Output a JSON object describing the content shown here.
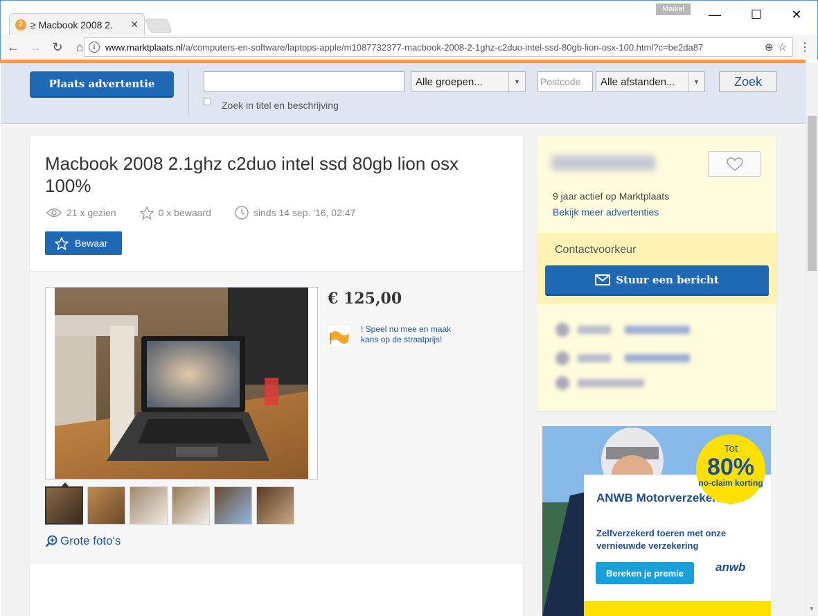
{
  "browser": {
    "tab_title": "≥ Macbook 2008 2.",
    "tab_badge": "2",
    "user": "Maikel",
    "url_domain": "www.marktplaats.nl",
    "url_path": "/a/computers-en-software/laptops-apple/m1087732377-macbook-2008-2-1ghz-c2duo-intel-ssd-80gb-lion-osx-100.html?c=be2da87"
  },
  "header": {
    "place_ad": "Plaats advertentie",
    "search_value": "",
    "groups_select": "Alle groepen...",
    "postcode_placeholder": "Postcode",
    "distance_select": "Alle afstanden...",
    "search_button": "Zoek",
    "title_desc_label": "Zoek in titel en beschrijving"
  },
  "listing": {
    "title": "Macbook 2008 2.1ghz c2duo intel ssd 80gb lion osx 100%",
    "views": "21 x gezien",
    "saves": "0 x bewaard",
    "since": "sinds 14 sep. '16, 02:47",
    "save_button": "Bewaar",
    "price": "€ 125,00",
    "promo": "! Speel nu mee en maak kans op de straatprijs!",
    "large_photos": "Grote foto's",
    "thumbnail_count": 6
  },
  "seller": {
    "active": "9 jaar actief op Marktplaats",
    "more_ads": "Bekijk meer advertenties",
    "contact_heading": "Contactvoorkeur",
    "message_button": "Stuur een bericht"
  },
  "ad": {
    "brand": "ANWB Motorverzekering",
    "body": "Zelfverzekerd toeren met onze vernieuwde verzekering",
    "cta": "Bereken je premie",
    "logo": "anwb",
    "badge_top": "Tot",
    "badge_big": "80%",
    "badge_small": "no-claim korting"
  },
  "colors": {
    "brand_blue": "#1f68b4",
    "accent_orange": "#ef9a55",
    "seller_bg": "#fffbdc"
  }
}
